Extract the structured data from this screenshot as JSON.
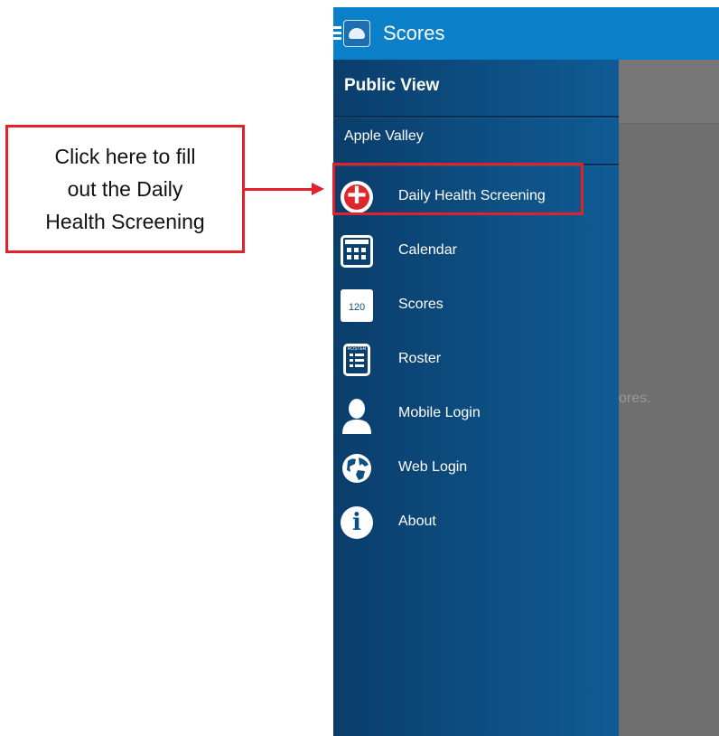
{
  "app": {
    "title": "Scores"
  },
  "drawer": {
    "section_title": "Public View",
    "subtitle": "Apple Valley",
    "items": [
      {
        "label": "Daily Health Screening",
        "icon": "health-cross-icon"
      },
      {
        "label": "Calendar",
        "icon": "calendar-icon"
      },
      {
        "label": "Scores",
        "icon": "scores-calendar-icon",
        "badge": "120"
      },
      {
        "label": "Roster",
        "icon": "roster-icon",
        "badge": "ROSTER"
      },
      {
        "label": "Mobile Login",
        "icon": "person-icon"
      },
      {
        "label": "Web Login",
        "icon": "globe-icon"
      },
      {
        "label": "About",
        "icon": "info-icon"
      }
    ]
  },
  "background_text": "ores.",
  "callout": {
    "text": "Click here to fill\nout the Daily\nHealth Screening"
  },
  "colors": {
    "topbar": "#0b7fc7",
    "drawer": "#0d4f82",
    "accent": "#e3212a"
  }
}
